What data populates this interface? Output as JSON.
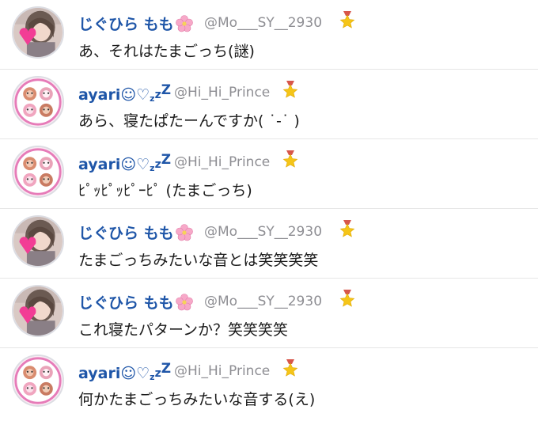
{
  "posts": [
    {
      "avatar": "photo-avatar",
      "name": "じぐひら もも",
      "name_emoji": "cherry-blossom-icon",
      "handle": "@Mo___SY__2930",
      "badge": "star-medal-icon",
      "text": "あ、それはたまごっち(謎)"
    },
    {
      "avatar": "illustration-avatar",
      "name": "ayari☺♡",
      "name_suffix": "zzZ",
      "handle": "@Hi_Hi_Prince",
      "badge": "star-medal-icon",
      "text": "あら、寝たぱたーんですか( ˙-˙ )"
    },
    {
      "avatar": "illustration-avatar",
      "name": "ayari☺♡",
      "name_suffix": "zzZ",
      "handle": "@Hi_Hi_Prince",
      "badge": "star-medal-icon",
      "text": "ﾋﾟｯﾋﾟｯﾋﾟｰﾋﾟ (たまごっち)"
    },
    {
      "avatar": "photo-avatar",
      "name": "じぐひら もも",
      "name_emoji": "cherry-blossom-icon",
      "handle": "@Mo___SY__2930",
      "badge": "star-medal-icon",
      "text": "たまごっちみたいな音とは笑笑笑笑"
    },
    {
      "avatar": "photo-avatar",
      "name": "じぐひら もも",
      "name_emoji": "cherry-blossom-icon",
      "handle": "@Mo___SY__2930",
      "badge": "star-medal-icon",
      "text": "これ寝たパターンか？笑笑笑笑"
    },
    {
      "avatar": "illustration-avatar",
      "name": "ayari☺♡",
      "name_suffix": "zzZ",
      "handle": "@Hi_Hi_Prince",
      "badge": "star-medal-icon",
      "text": "何かたまごっちみたいな音する(え)"
    }
  ],
  "colors": {
    "name": "#1f56a8",
    "handle": "#8e8e93",
    "text": "#1a1a1a",
    "divider": "#e6e6e6",
    "accent_pink": "#e67bb8"
  }
}
